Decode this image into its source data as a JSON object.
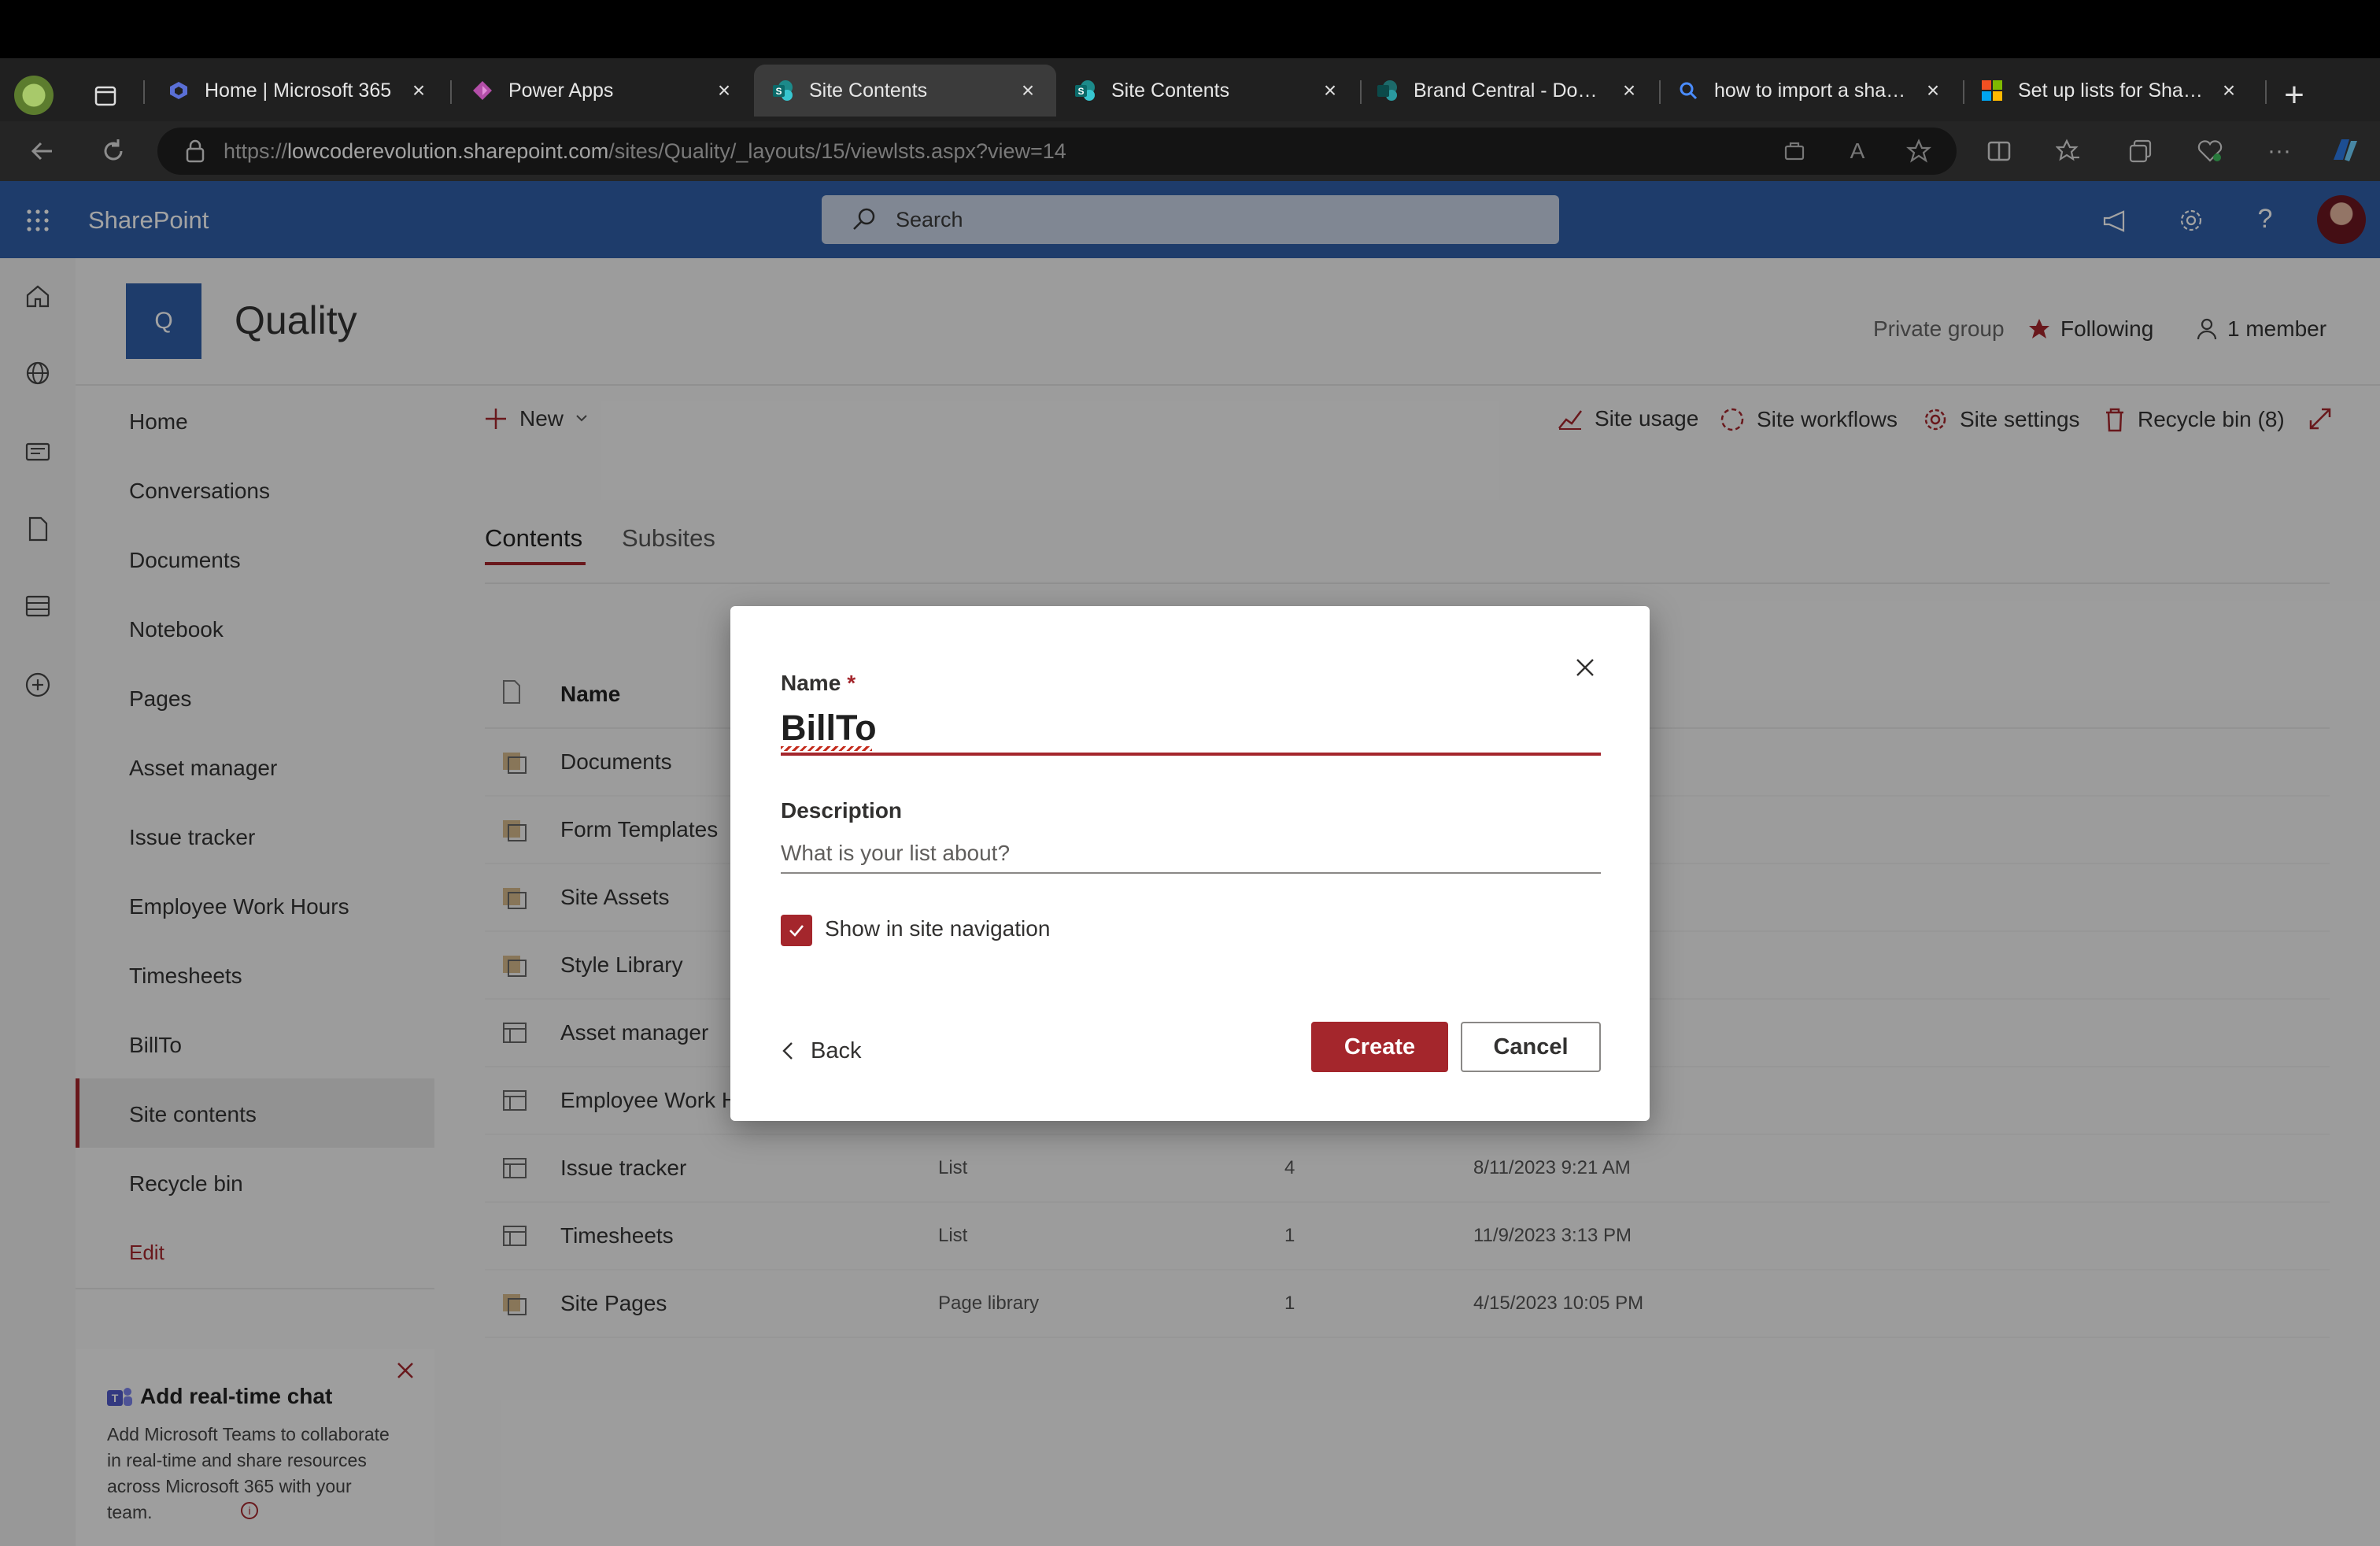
{
  "browser": {
    "tabs": [
      {
        "title": "Home | Microsoft 365",
        "icon": "microsoft365-icon"
      },
      {
        "title": "Power Apps",
        "icon": "powerapps-icon"
      },
      {
        "title": "Site Contents",
        "icon": "sharepoint-icon",
        "active": true
      },
      {
        "title": "Site Contents",
        "icon": "sharepoint-icon"
      },
      {
        "title": "Brand Central - Documents",
        "icon": "sharepoint-icon"
      },
      {
        "title": "how to import a sharepoint list",
        "icon": "search-icon"
      },
      {
        "title": "Set up lists for SharePoint",
        "icon": "microsoft-icon"
      }
    ],
    "tab_close": "×",
    "new_tab": "+",
    "url_prefix": "https://",
    "url_host": "lowcoderevolution.sharepoint.com",
    "url_path": "/sites/Quality/_layouts/15/viewlsts.aspx?view=14",
    "more": "···"
  },
  "suite": {
    "app_name": "SharePoint",
    "search_placeholder": "Search",
    "help": "?"
  },
  "site": {
    "logo_letter": "Q",
    "title": "Quality",
    "privacy": "Private group",
    "following": "Following",
    "members": "1 member"
  },
  "nav": {
    "items": [
      "Home",
      "Conversations",
      "Documents",
      "Notebook",
      "Pages",
      "Asset manager",
      "Issue tracker",
      "Employee Work Hours",
      "Timesheets",
      "BillTo",
      "Site contents",
      "Recycle bin"
    ],
    "edit": "Edit"
  },
  "chat_card": {
    "title": "Add real-time chat",
    "body": "Add Microsoft Teams to collaborate in real-time and share resources across Microsoft 365 with your team."
  },
  "commandbar": {
    "new": "New",
    "site_usage": "Site usage",
    "site_workflows": "Site workflows",
    "site_settings": "Site settings",
    "recycle_bin": "Recycle bin (8)"
  },
  "content_tabs": {
    "contents": "Contents",
    "subsites": "Subsites"
  },
  "table": {
    "col_name": "Name",
    "rows": [
      {
        "name": "Documents",
        "type": "",
        "items": "",
        "modified": "",
        "kind": "library"
      },
      {
        "name": "Form Templates",
        "type": "",
        "items": "",
        "modified": "",
        "kind": "library"
      },
      {
        "name": "Site Assets",
        "type": "",
        "items": "",
        "modified": "",
        "kind": "library"
      },
      {
        "name": "Style Library",
        "type": "",
        "items": "",
        "modified": "",
        "kind": "library"
      },
      {
        "name": "Asset manager",
        "type": "",
        "items": "",
        "modified": "",
        "kind": "list"
      },
      {
        "name": "Employee Work H",
        "type": "",
        "items": "",
        "modified": "",
        "kind": "list"
      },
      {
        "name": "Issue tracker",
        "type": "List",
        "items": "4",
        "modified": "8/11/2023 9:21 AM",
        "kind": "list"
      },
      {
        "name": "Timesheets",
        "type": "List",
        "items": "1",
        "modified": "11/9/2023 3:13 PM",
        "kind": "list"
      },
      {
        "name": "Site Pages",
        "type": "Page library",
        "items": "1",
        "modified": "4/15/2023 10:05 PM",
        "kind": "library"
      }
    ]
  },
  "dialog": {
    "name_label": "Name",
    "required_mark": "*",
    "name_value": "BillTo",
    "description_label": "Description",
    "description_placeholder": "What is your list about?",
    "show_in_nav_label": "Show in site navigation",
    "show_in_nav_checked": true,
    "back": "Back",
    "create": "Create",
    "cancel": "Cancel"
  },
  "colors": {
    "accent": "#a4262c",
    "suite": "#2f5fa8"
  }
}
